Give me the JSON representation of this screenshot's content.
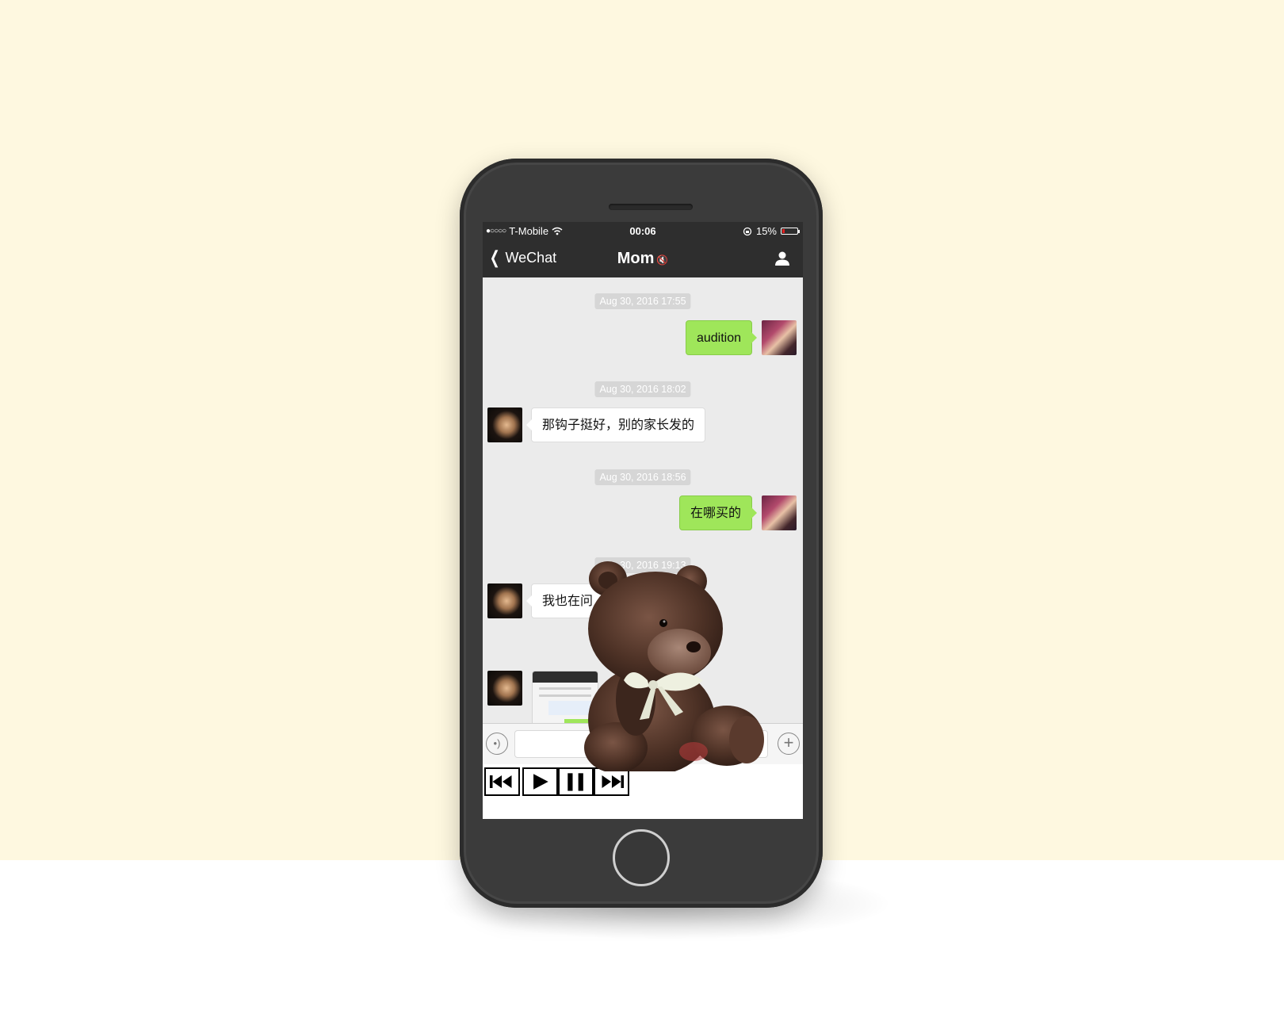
{
  "status_bar": {
    "signal": "●○○○○",
    "carrier": "T-Mobile",
    "time": "00:06",
    "battery_percent": "15%",
    "battery_level": 0.15
  },
  "nav": {
    "back_label": "WeChat",
    "title": "Mom"
  },
  "messages": [
    {
      "timestamp": "Aug 30, 2016 17:55",
      "sender": "me",
      "text": "audition"
    },
    {
      "timestamp": "Aug 30, 2016 18:02",
      "sender": "mom",
      "text": "那钩子挺好，别的家长发的"
    },
    {
      "timestamp": "Aug 30, 2016 18:56",
      "sender": "me",
      "text": "在哪买的"
    },
    {
      "timestamp": "Aug 30, 2016 19:13",
      "sender": "mom",
      "text": "我也在问"
    },
    {
      "timestamp": "",
      "sender": "mom",
      "text": "",
      "type": "image"
    }
  ],
  "icons": {
    "back": "chevron-left-icon",
    "mute": "mute-icon",
    "profile": "person-icon",
    "voice": "voice-icon",
    "plus": "plus-icon",
    "media": [
      "skip-back-icon",
      "play-icon",
      "pause-icon",
      "skip-forward-icon"
    ]
  },
  "colors": {
    "background_top": "#fef8e0",
    "phone_body": "#3b3b3b",
    "nav_bar": "#2e2e2e",
    "outgoing_bubble": "#9fe65a",
    "incoming_bubble": "#ffffff",
    "chat_background": "#ebebeb"
  }
}
